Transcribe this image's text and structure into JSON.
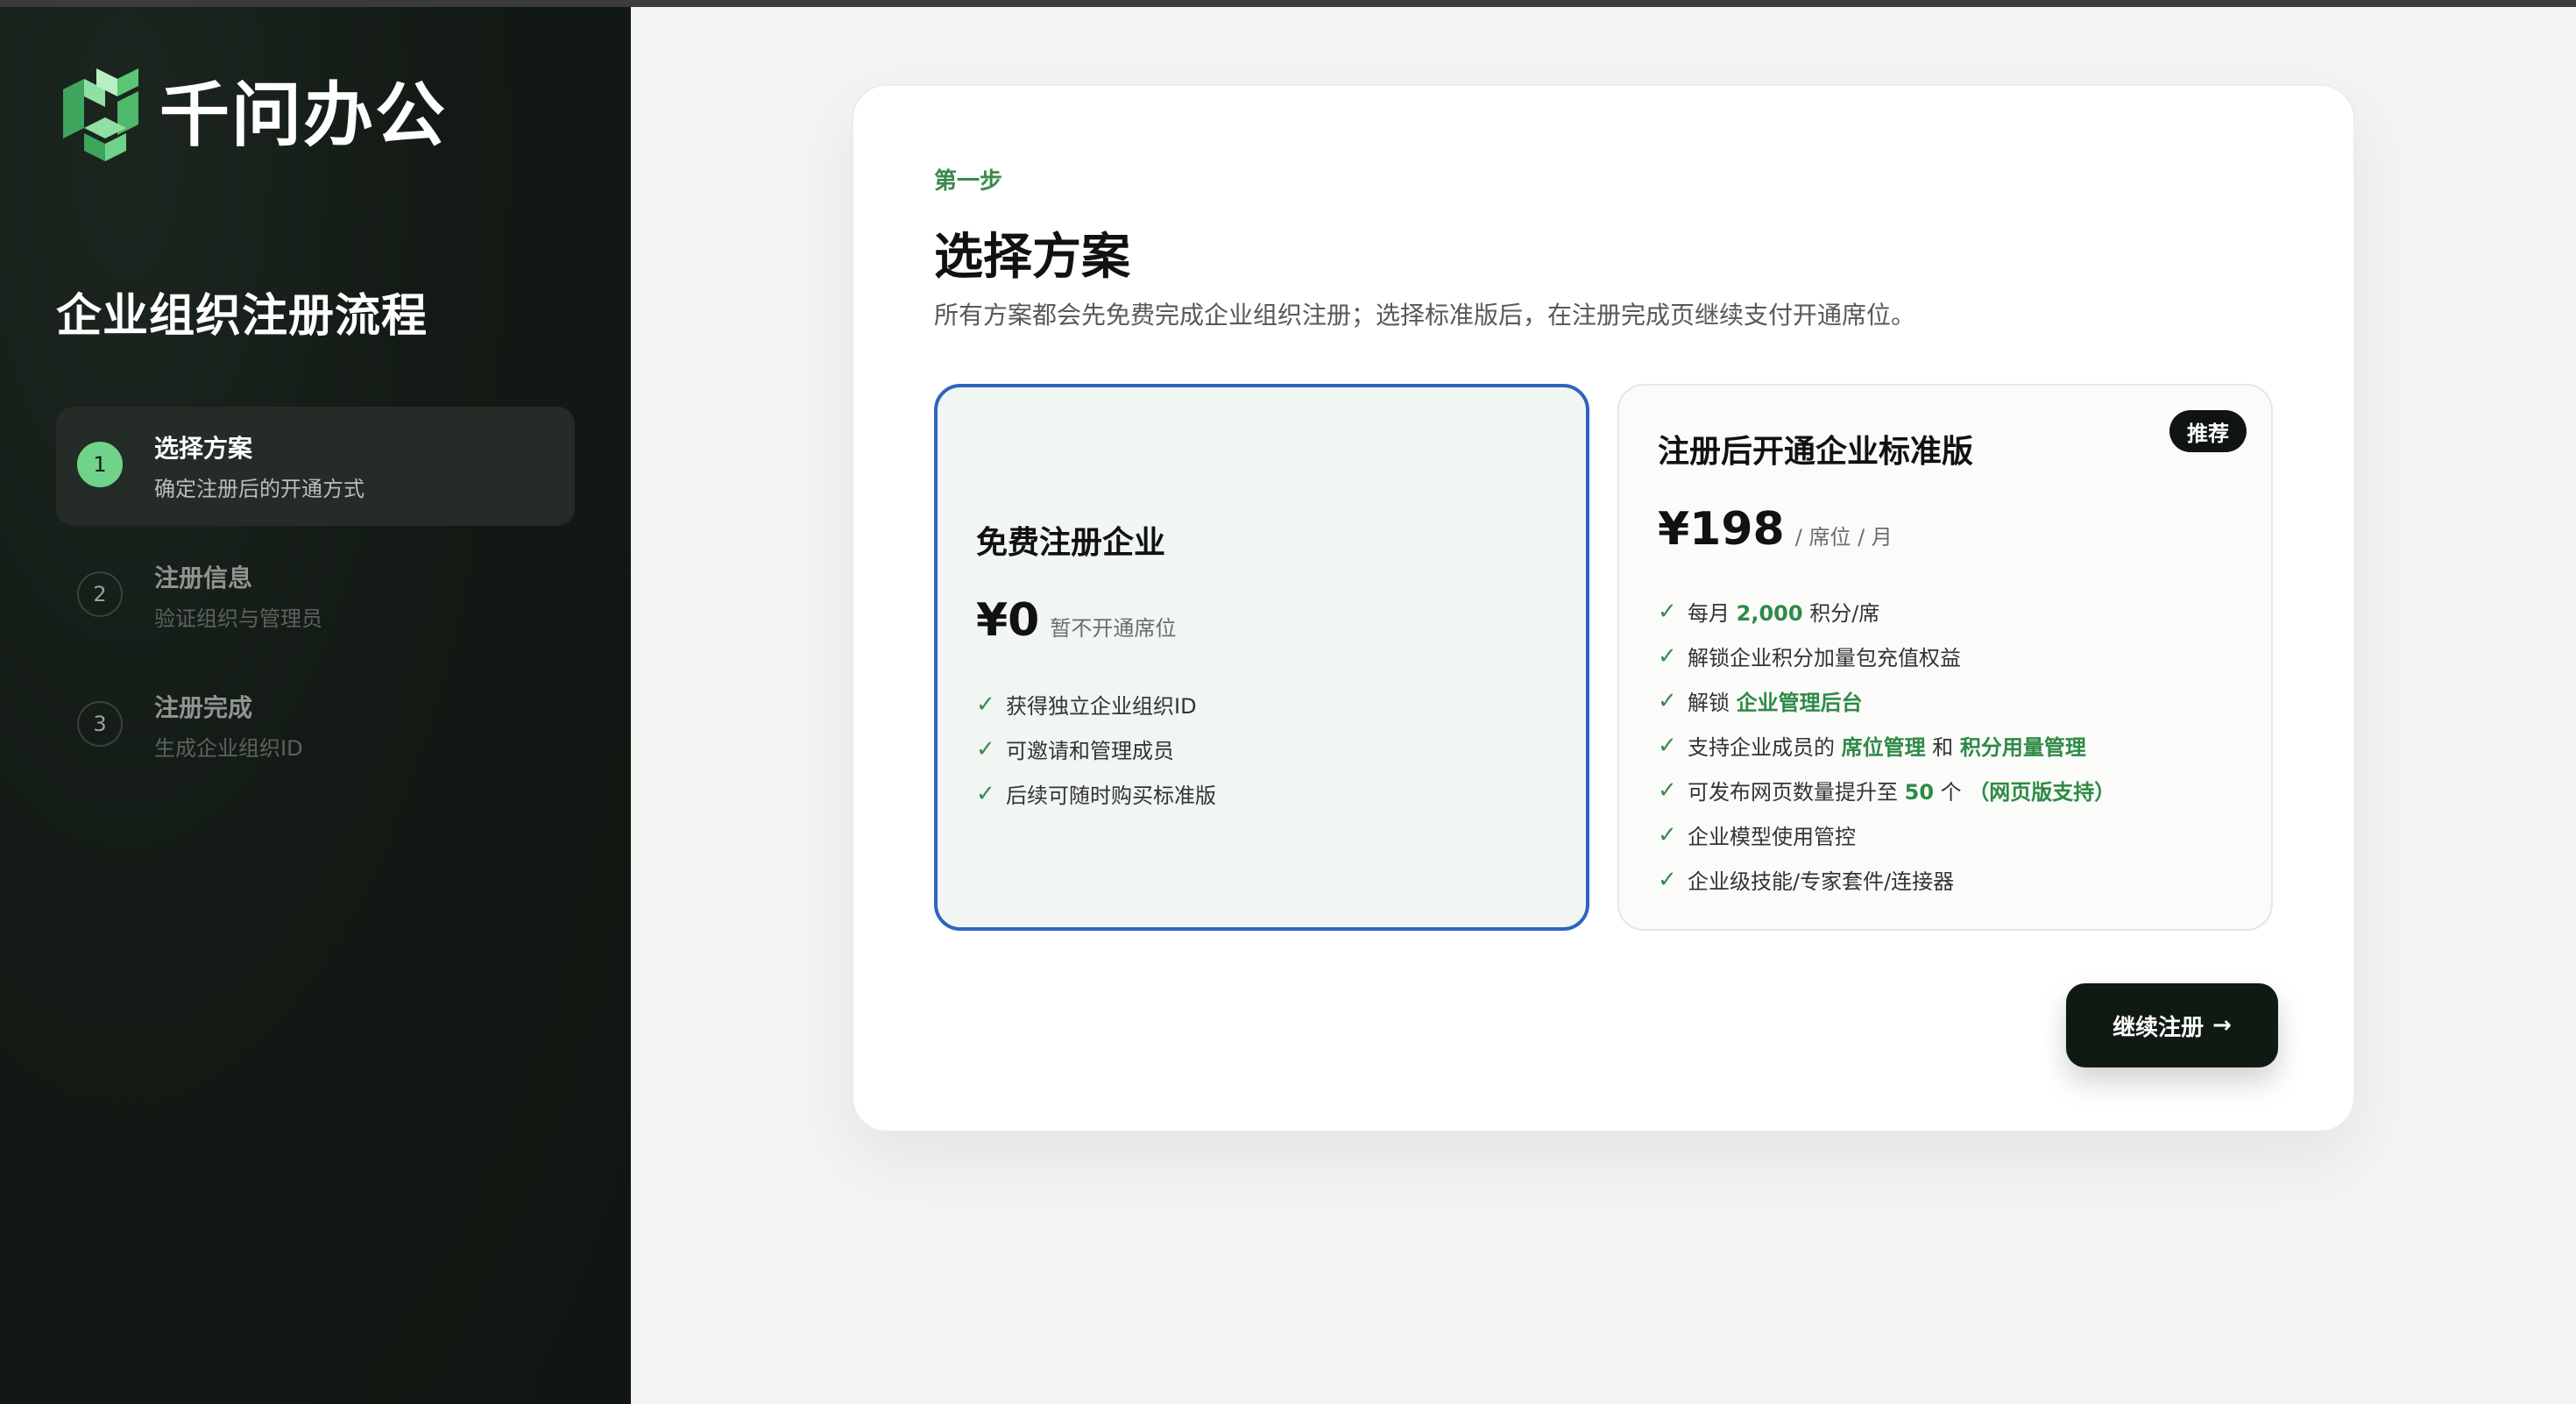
{
  "brand": {
    "name": "千问办公"
  },
  "sidebar": {
    "title": "企业组织注册流程",
    "steps": [
      {
        "num": "1",
        "label": "选择方案",
        "desc": "确定注册后的开通方式",
        "active": true
      },
      {
        "num": "2",
        "label": "注册信息",
        "desc": "验证组织与管理员",
        "active": false
      },
      {
        "num": "3",
        "label": "注册完成",
        "desc": "生成企业组织ID",
        "active": false
      }
    ]
  },
  "main": {
    "step_tag": "第一步",
    "title": "选择方案",
    "subtitle": "所有方案都会先免费完成企业组织注册；选择标准版后，在注册完成页继续支付开通席位。",
    "plans": {
      "free": {
        "name": "免费注册企业",
        "price": "¥0",
        "price_note": "暂不开通席位",
        "features": [
          "获得独立企业组织ID",
          "可邀请和管理成员",
          "后续可随时购买标准版"
        ],
        "selected": true
      },
      "standard": {
        "badge": "推荐",
        "name": "注册后开通企业标准版",
        "price": "¥198",
        "price_note": "/ 席位 / 月",
        "features": {
          "f1_a": "每月 ",
          "f1_hl": "2,000",
          "f1_b": " 积分/席",
          "f2": "解锁企业积分加量包充值权益",
          "f3_a": "解锁 ",
          "f3_hl": "企业管理后台",
          "f4_a": "支持企业成员的 ",
          "f4_hl1": "席位管理",
          "f4_b": " 和 ",
          "f4_hl2": "积分用量管理",
          "f5_a": "可发布网页数量提升至 ",
          "f5_hl1": "50",
          "f5_b": " 个 ",
          "f5_hl2": "（网页版支持）",
          "f6": "企业模型使用管控",
          "f7": "企业级技能/专家套件/连接器"
        }
      }
    },
    "continue_label": "继续注册",
    "continue_arrow": "→"
  },
  "icons": {
    "check": "check-icon",
    "arrow": "arrow-right-icon",
    "logo": "qianwen-logo-icon"
  },
  "colors": {
    "accent_green": "#3a8a4c",
    "selected_border": "#2e64c0",
    "sidebar_bg": "#131a15",
    "step_active_dot": "#6fd489"
  }
}
